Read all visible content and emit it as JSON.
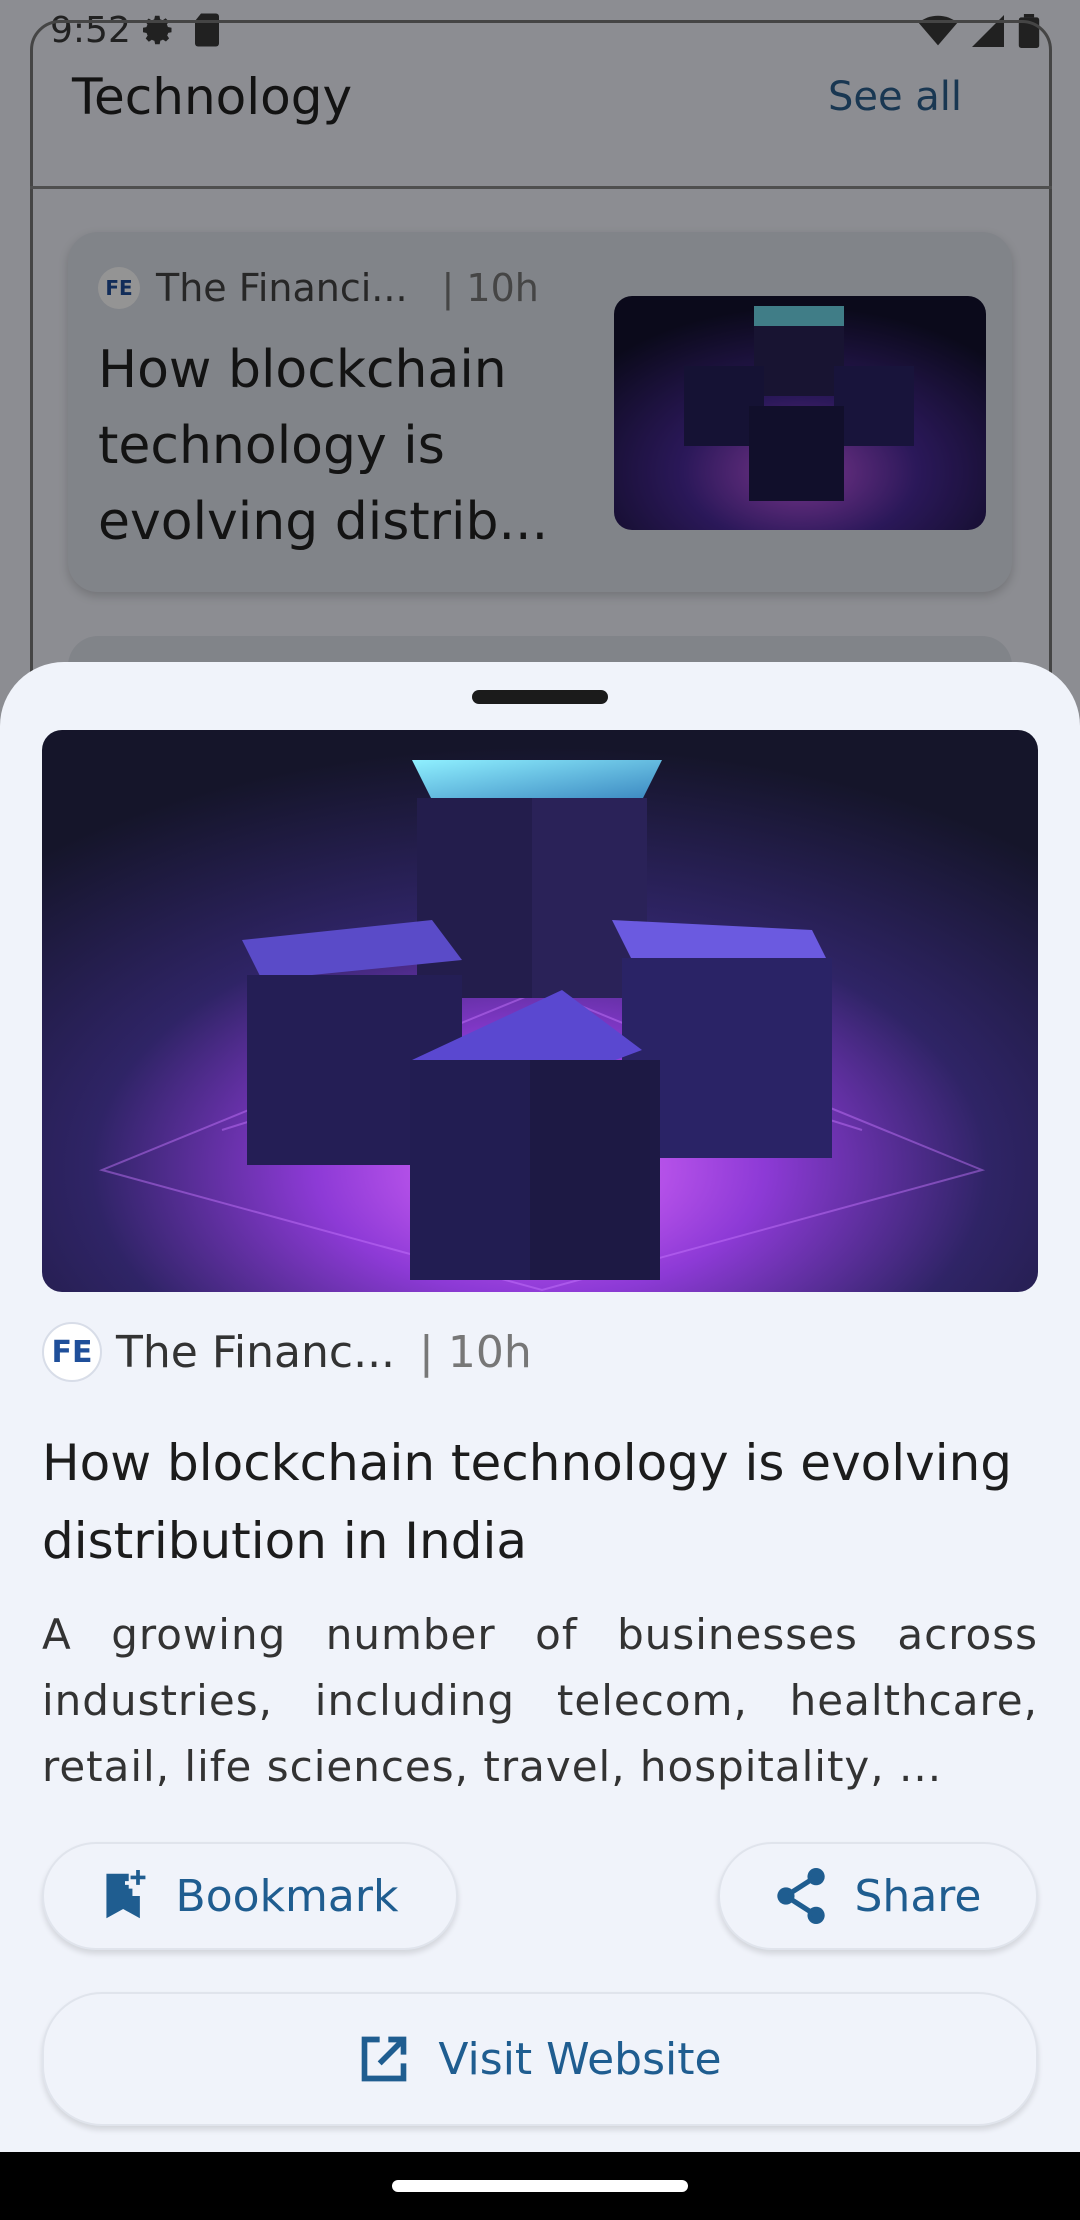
{
  "status_bar": {
    "time": "9:52"
  },
  "background": {
    "section_title": "Technology",
    "see_all": "See all",
    "card": {
      "source": "The Financi...",
      "time": "| 10h",
      "title": "How blockchain technology is evolving distrib..."
    }
  },
  "sheet": {
    "source": "The Financ...",
    "time": "| 10h",
    "headline": "How blockchain technology is evolving distribution in India",
    "summary": "A growing number of businesses across industries, including telecom, healthcare, retail, life sciences, travel, hospitality, ...",
    "buttons": {
      "bookmark": "Bookmark",
      "share": "Share",
      "visit": "Visit Website"
    },
    "logo_text": "FE"
  },
  "colors": {
    "accent": "#1f5d90",
    "sheet_bg": "#f0f3fa"
  }
}
